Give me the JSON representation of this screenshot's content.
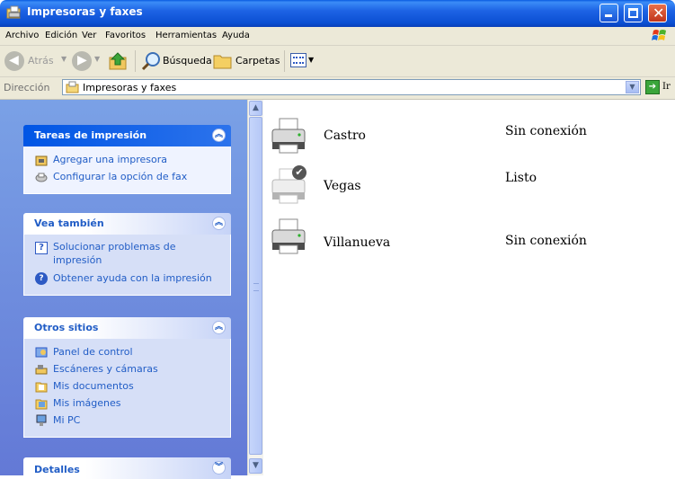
{
  "window": {
    "title": "Impresoras y faxes"
  },
  "menu": [
    "Archivo",
    "Edición",
    "Ver",
    "Favoritos",
    "Herramientas",
    "Ayuda"
  ],
  "toolbar": {
    "back": "Atrás",
    "search": "Búsqueda",
    "folders": "Carpetas"
  },
  "address": {
    "label": "Dirección",
    "value": "Impresoras y faxes",
    "go": "Ir"
  },
  "panels": {
    "tasks": {
      "title": "Tareas de impresión",
      "items": [
        "Agregar una impresora",
        "Configurar la opción de fax"
      ]
    },
    "see_also": {
      "title": "Vea también",
      "items": [
        "Solucionar problemas de impresión",
        "Obtener ayuda con la impresión"
      ]
    },
    "other": {
      "title": "Otros sitios",
      "items": [
        "Panel de control",
        "Escáneres y cámaras",
        "Mis documentos",
        "Mis imágenes",
        "Mi PC"
      ]
    },
    "details": {
      "title": "Detalles"
    }
  },
  "printers": [
    {
      "name": "Castro",
      "status": "Sin conexión",
      "default": false
    },
    {
      "name": "Vegas",
      "status": "Listo",
      "default": true
    },
    {
      "name": "Villanueva",
      "status": "Sin conexión",
      "default": false
    }
  ],
  "colors": {
    "titlebar": "#0b4fd3",
    "pane_link": "#215dc6",
    "chrome": "#ece9d8"
  }
}
